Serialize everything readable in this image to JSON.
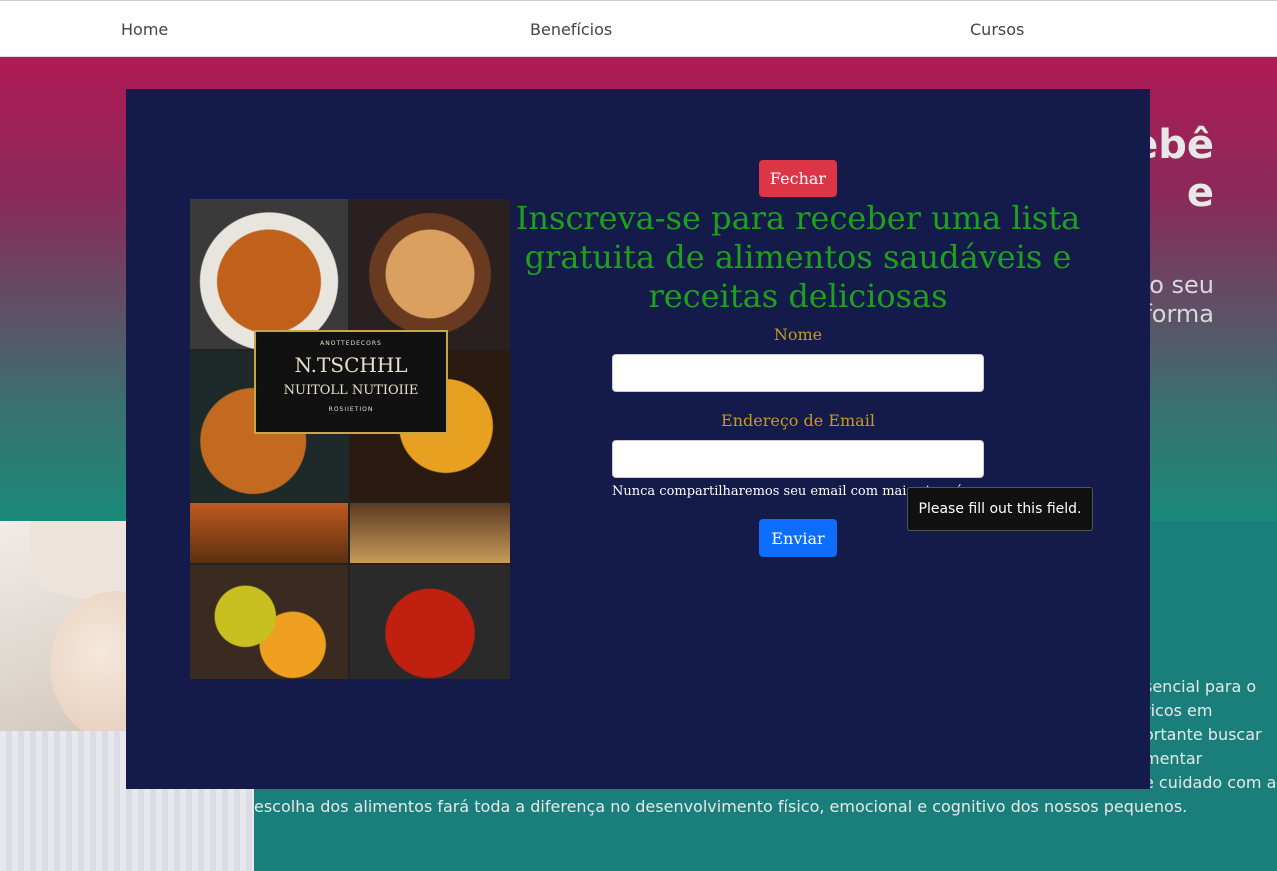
{
  "nav": {
    "items": [
      {
        "label": "Home"
      },
      {
        "label": "Benefícios"
      },
      {
        "label": "Cursos"
      }
    ]
  },
  "hero": {
    "title_fragment_1": "ebê",
    "title_fragment_2": "e",
    "subtitle_fragment_1": "o seu",
    "subtitle_fragment_2": "forma"
  },
  "lower": {
    "text_fragments": [
      "sencial para o",
      "ricos em",
      "ortante buscar",
      "mentar",
      "e cuidado com a",
      "escolha dos alimentos fará toda a diferença no desenvolvimento físico, emocional e cognitivo dos nossos pequenos."
    ]
  },
  "modal": {
    "close_label": "Fechar",
    "title": "Inscreva-se para receber uma lista gratuita de alimentos saudáveis e receitas deliciosas",
    "name_label": "Nome",
    "name_value": "",
    "email_label": "Endereço de Email",
    "email_value": "",
    "email_help": "Nunca compartilharemos seu email com mais ninguém.",
    "submit_label": "Enviar",
    "validation_tooltip": "Please fill out this field.",
    "cover": {
      "small_top": "ANOTTEDECORS",
      "title_line1": "N.TSCHHL",
      "title_line2": "NUITOLL NUTIOIIE",
      "small_bottom": "ROSIIETION"
    }
  }
}
